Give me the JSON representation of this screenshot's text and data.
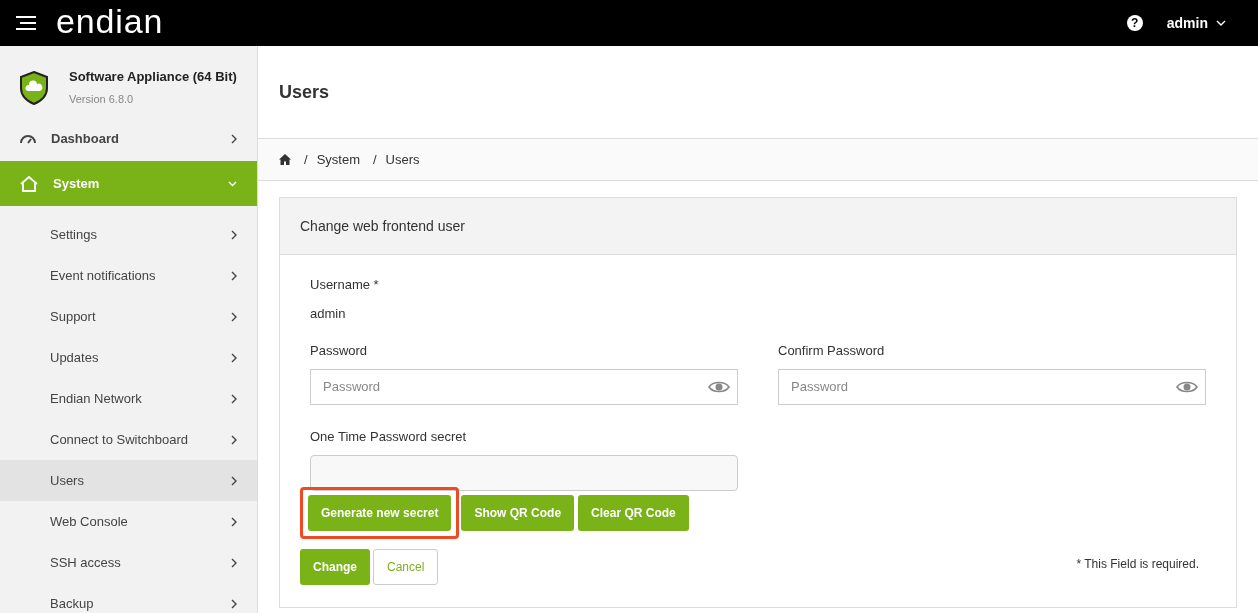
{
  "topbar": {
    "logo": "endian",
    "help": "?",
    "user": "admin"
  },
  "sidebar": {
    "product": "Software Appliance (64 Bit)",
    "version": "Version 6.8.0",
    "items": [
      {
        "label": "Dashboard",
        "kind": "dashboard",
        "expanded": false,
        "selected": false
      },
      {
        "label": "System",
        "kind": "system",
        "expanded": true,
        "selected": true,
        "children": [
          {
            "label": "Settings",
            "selected": false
          },
          {
            "label": "Event notifications",
            "selected": false
          },
          {
            "label": "Support",
            "selected": false
          },
          {
            "label": "Updates",
            "selected": false
          },
          {
            "label": "Endian Network",
            "selected": false
          },
          {
            "label": "Connect to Switchboard",
            "selected": false
          },
          {
            "label": "Users",
            "selected": true
          },
          {
            "label": "Web Console",
            "selected": false
          },
          {
            "label": "SSH access",
            "selected": false
          },
          {
            "label": "Backup",
            "selected": false
          }
        ]
      }
    ]
  },
  "page_title": "Users",
  "breadcrumb": [
    {
      "separator": "/",
      "label": "System"
    },
    {
      "separator": "/",
      "label": "Users"
    }
  ],
  "card": {
    "title": "Change web frontend user",
    "username_label": "Username *",
    "username_value": "admin",
    "password_label": "Password",
    "password_placeholder": "Password",
    "confirm_label": "Confirm Password",
    "confirm_placeholder": "Password",
    "otp_label": "One Time Password secret",
    "otp_buttons": [
      {
        "label": "Generate new secret",
        "highlighted": true
      },
      {
        "label": "Show QR Code",
        "highlighted": false
      },
      {
        "label": "Clear QR Code",
        "highlighted": false
      }
    ],
    "actions": [
      {
        "label": "Change",
        "kind": "primary"
      },
      {
        "label": "Cancel",
        "kind": "secondary"
      }
    ],
    "required_note": "* This Field is required."
  }
}
